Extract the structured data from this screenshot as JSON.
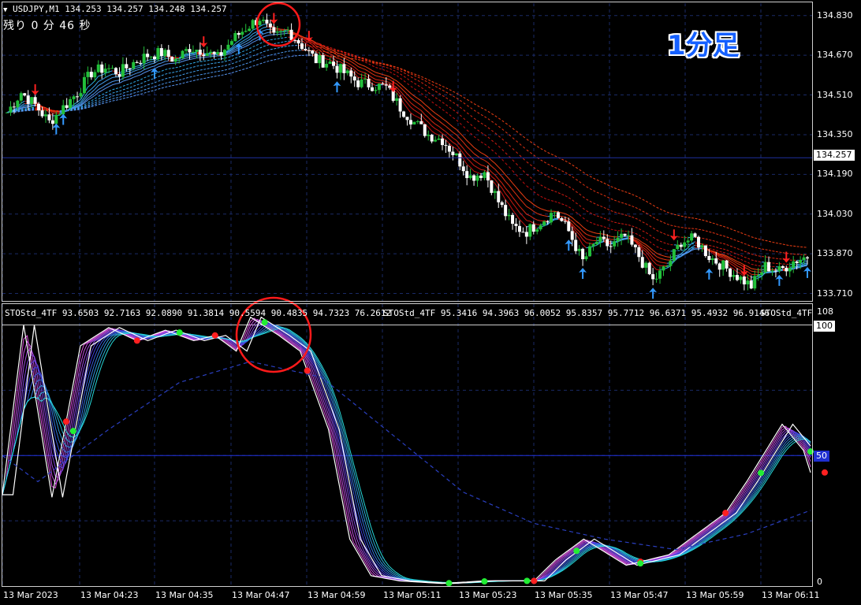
{
  "symbol_header": "USDJPY,M1  134.253 134.257 134.248 134.257",
  "countdown": "残り 0 分 46 秒",
  "timeframe_badge": "1分足",
  "main_price_labels": [
    "134.830",
    "134.670",
    "134.510",
    "134.350",
    "134.190",
    "134.030",
    "133.870",
    "133.710"
  ],
  "current_price": "134.257",
  "indicator_header": {
    "part1": "STOStd_4TF 93.6503 92.7163 92.0890 91.3814 90.5594 90.4835 94.7323 76.2612",
    "part2": "STOStd_4TF 95.3416 94.3963 96.0052 95.8357 95.7712 96.6371 95.4932 96.9146",
    "part3": "STOStd_4TF"
  },
  "indicator_scale": {
    "top": "108",
    "upper": "100",
    "mid": "50",
    "bottom": "0"
  },
  "time_axis": [
    "13 Mar 2023",
    "13 Mar 04:23",
    "13 Mar 04:35",
    "13 Mar 04:47",
    "13 Mar 04:59",
    "13 Mar 05:11",
    "13 Mar 05:23",
    "13 Mar 05:35",
    "13 Mar 05:47",
    "13 Mar 05:59",
    "13 Mar 06:11"
  ],
  "colors": {
    "background": "#000000",
    "grid": "#1a2a66",
    "bull_candle": "#22c03a",
    "bear_candle": "#ffffff",
    "up_arrow": "#3399ff",
    "down_arrow": "#ff2020",
    "current_price_line": "#1f2fa0",
    "highlight_circle": "#ff1a1a",
    "badge_text": "#1560ff"
  },
  "chart_data": [
    {
      "type": "candlestick",
      "title": "USDJPY,M1",
      "ylim": [
        133.68,
        134.88
      ],
      "x": [
        "13 Mar 2023",
        "13 Mar 04:23",
        "13 Mar 04:35",
        "13 Mar 04:47",
        "13 Mar 04:59",
        "13 Mar 05:11",
        "13 Mar 05:23",
        "13 Mar 05:35",
        "13 Mar 05:47",
        "13 Mar 05:59",
        "13 Mar 06:11"
      ],
      "close_path": [
        [
          0,
          134.44
        ],
        [
          4,
          134.52
        ],
        [
          8,
          134.47
        ],
        [
          12,
          134.4
        ],
        [
          16,
          134.46
        ],
        [
          20,
          134.52
        ],
        [
          24,
          134.6
        ],
        [
          28,
          134.62
        ],
        [
          32,
          134.6
        ],
        [
          36,
          134.64
        ],
        [
          40,
          134.67
        ],
        [
          44,
          134.68
        ],
        [
          48,
          134.65
        ],
        [
          52,
          134.7
        ],
        [
          56,
          134.69
        ],
        [
          60,
          134.66
        ],
        [
          64,
          134.73
        ],
        [
          68,
          134.78
        ],
        [
          72,
          134.82
        ],
        [
          76,
          134.74
        ],
        [
          80,
          134.77
        ],
        [
          84,
          134.71
        ],
        [
          88,
          134.65
        ],
        [
          92,
          134.64
        ],
        [
          96,
          134.6
        ],
        [
          100,
          134.56
        ],
        [
          104,
          134.55
        ],
        [
          108,
          134.54
        ],
        [
          112,
          134.46
        ],
        [
          116,
          134.4
        ],
        [
          120,
          134.35
        ],
        [
          124,
          134.33
        ],
        [
          128,
          134.26
        ],
        [
          132,
          134.18
        ],
        [
          136,
          134.2
        ],
        [
          140,
          134.08
        ],
        [
          144,
          133.98
        ],
        [
          148,
          133.96
        ],
        [
          152,
          134.0
        ],
        [
          156,
          134.04
        ],
        [
          160,
          133.96
        ],
        [
          164,
          133.84
        ],
        [
          168,
          133.92
        ],
        [
          172,
          133.9
        ],
        [
          176,
          133.94
        ],
        [
          180,
          133.86
        ],
        [
          184,
          133.76
        ],
        [
          188,
          133.82
        ],
        [
          192,
          133.92
        ],
        [
          196,
          133.93
        ],
        [
          200,
          133.86
        ],
        [
          204,
          133.82
        ],
        [
          208,
          133.78
        ],
        [
          212,
          133.74
        ],
        [
          216,
          133.82
        ],
        [
          220,
          133.8
        ],
        [
          224,
          133.84
        ],
        [
          228,
          133.86
        ]
      ],
      "ma_tail_end": 133.74
    },
    {
      "type": "line",
      "title": "STOStd_4TF",
      "ylim": [
        0,
        108
      ],
      "levels": [
        50,
        100
      ],
      "series": [
        {
          "values": [
            [
              0,
              35
            ],
            [
              6,
              100
            ],
            [
              14,
              34
            ],
            [
              22,
              92
            ],
            [
              30,
              99
            ],
            [
              38,
              94
            ],
            [
              46,
              98
            ],
            [
              54,
              94
            ],
            [
              60,
              96
            ],
            [
              66,
              90
            ],
            [
              70,
              103
            ],
            [
              78,
              96
            ],
            [
              84,
              90
            ],
            [
              92,
              60
            ],
            [
              98,
              18
            ],
            [
              104,
              4
            ],
            [
              112,
              2
            ],
            [
              124,
              1
            ],
            [
              136,
              2
            ],
            [
              150,
              2
            ],
            [
              156,
              10
            ],
            [
              164,
              18
            ],
            [
              176,
              8
            ],
            [
              188,
              12
            ],
            [
              196,
              20
            ],
            [
              204,
              28
            ],
            [
              210,
              40
            ],
            [
              220,
              62
            ],
            [
              226,
              52
            ],
            [
              234,
              18
            ],
            [
              242,
              40
            ],
            [
              250,
              58
            ]
          ]
        },
        {
          "values": [
            [
              0,
              50
            ],
            [
              10,
              40
            ],
            [
              30,
              60
            ],
            [
              50,
              78
            ],
            [
              70,
              86
            ],
            [
              90,
              80
            ],
            [
              110,
              58
            ],
            [
              130,
              36
            ],
            [
              150,
              24
            ],
            [
              170,
              18
            ],
            [
              190,
              14
            ],
            [
              210,
              20
            ],
            [
              230,
              30
            ],
            [
              250,
              38
            ]
          ]
        }
      ]
    }
  ]
}
